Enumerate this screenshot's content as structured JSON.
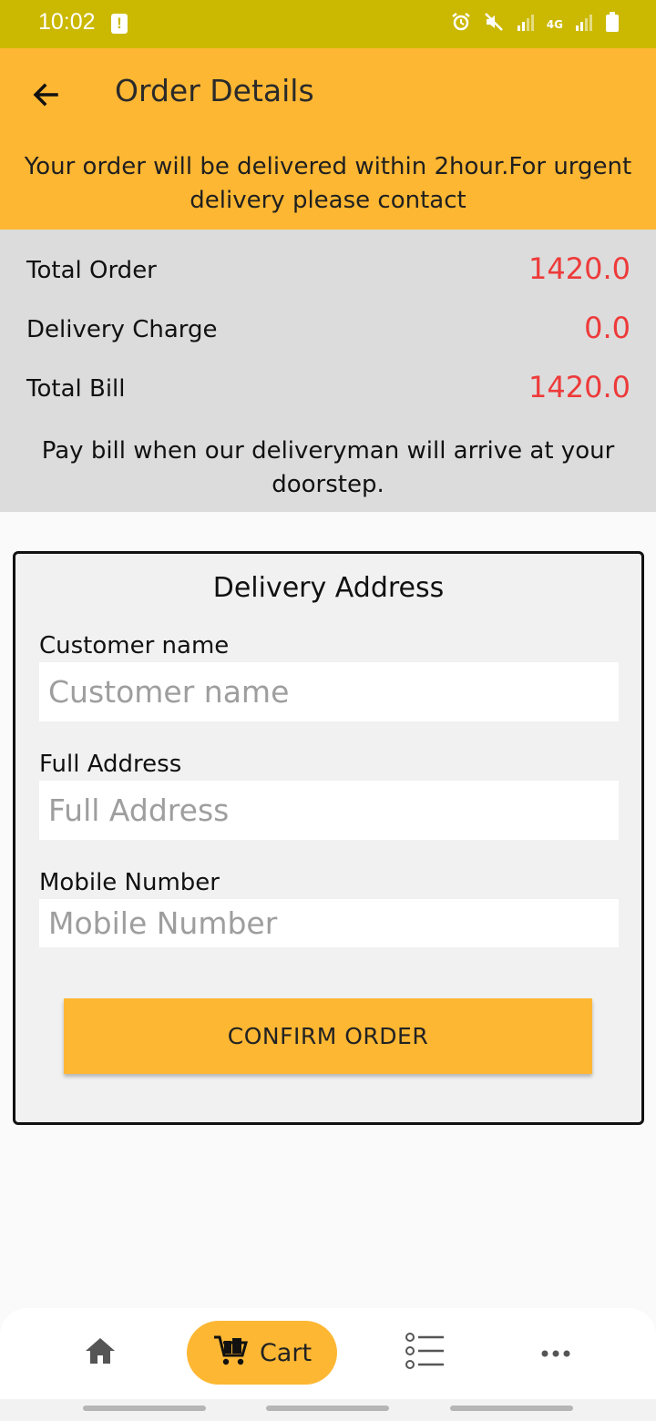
{
  "status_bar": {
    "time": "10:02",
    "warning_symbol": "!",
    "icons": [
      "alarm-icon",
      "mute-icon",
      "signal-icon",
      "4g-icon",
      "signal-icon",
      "battery-icon"
    ],
    "network_label": "4G"
  },
  "header": {
    "title": "Order Details",
    "notice": "Your order will be delivered within 2hour.For urgent delivery please contact"
  },
  "summary": {
    "total_order_label": "Total Order",
    "total_order_value": "1420.0",
    "delivery_charge_label": "Delivery Charge",
    "delivery_charge_value": "0.0",
    "total_bill_label": "Total Bill",
    "total_bill_value": "1420.0",
    "pay_note": "Pay bill when our deliveryman will arrive at your doorstep."
  },
  "delivery_form": {
    "title": "Delivery Address",
    "customer_name_label": "Customer name",
    "customer_name_placeholder": "Customer name",
    "full_address_label": "Full Address",
    "full_address_placeholder": "Full Address",
    "mobile_label": "Mobile Number",
    "mobile_placeholder": "Mobile Number",
    "confirm_label": "CONFIRM ORDER"
  },
  "bottom_nav": {
    "items": [
      {
        "icon": "home-icon"
      },
      {
        "icon": "cart-icon",
        "label": "Cart",
        "active": true
      },
      {
        "icon": "list-icon"
      },
      {
        "icon": "more-icon"
      }
    ]
  },
  "colors": {
    "accent": "#fdb733",
    "status_bar": "#cbb800",
    "price": "#ee3a3a",
    "summary_bg": "#dcdcdc"
  }
}
